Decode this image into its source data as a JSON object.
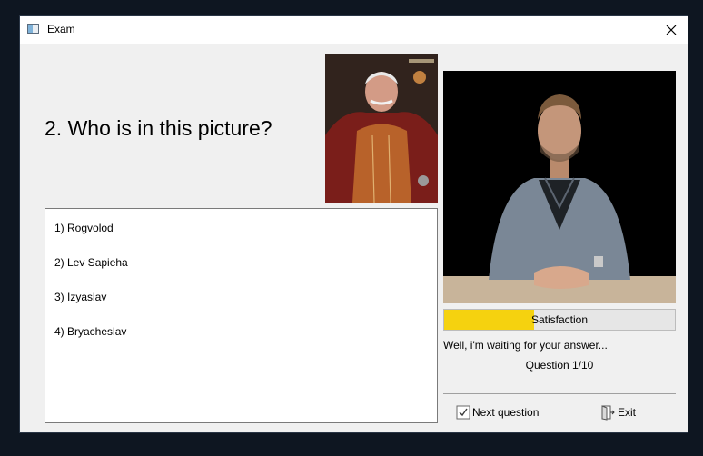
{
  "window": {
    "title": "Exam",
    "close_icon": "close-icon"
  },
  "question": {
    "text": "2. Who is in this picture?"
  },
  "answers": [
    {
      "label": "1) Rogvolod"
    },
    {
      "label": "2) Lev Sapieha"
    },
    {
      "label": "3) Izyaslav"
    },
    {
      "label": "4) Bryacheslav"
    }
  ],
  "satisfaction": {
    "label": "Satisfaction",
    "fraction": 0.39,
    "color": "#f5d20f"
  },
  "status": {
    "message": "Well, i'm waiting for your answer...",
    "question_counter": "Question 1/10"
  },
  "buttons": {
    "next_label": "Next question",
    "next_icon": "checkbox-check-icon",
    "exit_label": "Exit",
    "exit_icon": "door-exit-icon"
  }
}
